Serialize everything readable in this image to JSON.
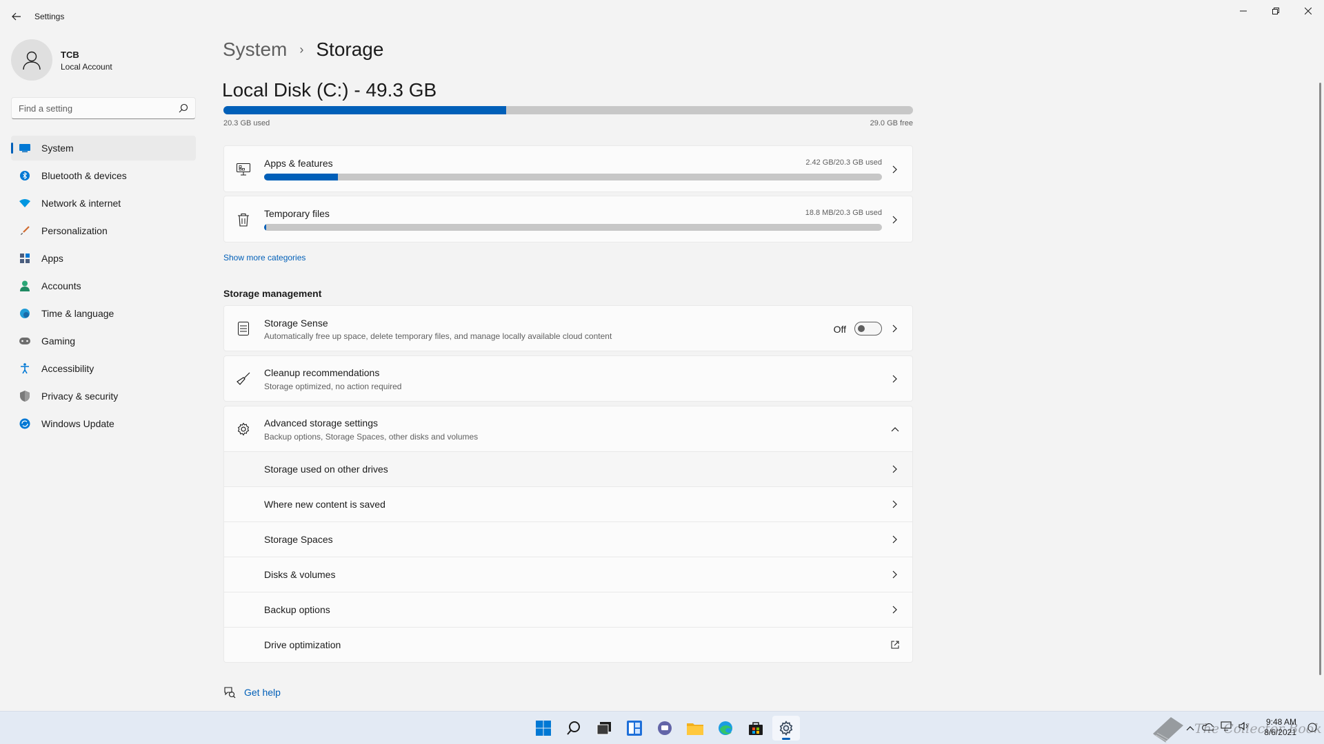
{
  "window": {
    "title": "Settings"
  },
  "user": {
    "name": "TCB",
    "account_type": "Local Account"
  },
  "search": {
    "placeholder": "Find a setting"
  },
  "sidebar": {
    "items": [
      {
        "label": "System",
        "icon": "system-icon",
        "active": true
      },
      {
        "label": "Bluetooth & devices",
        "icon": "bluetooth-icon"
      },
      {
        "label": "Network & internet",
        "icon": "wifi-icon"
      },
      {
        "label": "Personalization",
        "icon": "brush-icon"
      },
      {
        "label": "Apps",
        "icon": "apps-icon"
      },
      {
        "label": "Accounts",
        "icon": "person-icon"
      },
      {
        "label": "Time & language",
        "icon": "globe-icon"
      },
      {
        "label": "Gaming",
        "icon": "gamepad-icon"
      },
      {
        "label": "Accessibility",
        "icon": "accessibility-icon"
      },
      {
        "label": "Privacy & security",
        "icon": "shield-icon"
      },
      {
        "label": "Windows Update",
        "icon": "update-icon"
      }
    ]
  },
  "breadcrumb": {
    "parent": "System",
    "separator": "›",
    "current": "Storage"
  },
  "disk": {
    "title": "Local Disk (C:) - 49.3 GB",
    "used_label": "20.3 GB used",
    "free_label": "29.0 GB free",
    "used_fraction": 0.41
  },
  "categories": [
    {
      "title": "Apps & features",
      "usage": "2.42 GB/20.3 GB used",
      "fraction": 0.119,
      "icon": "apps-features-icon"
    },
    {
      "title": "Temporary files",
      "usage": "18.8 MB/20.3 GB used",
      "fraction": 0.001,
      "icon": "trash-icon"
    }
  ],
  "show_more": "Show more categories",
  "storage_management": {
    "heading": "Storage management",
    "storage_sense": {
      "title": "Storage Sense",
      "description": "Automatically free up space, delete temporary files, and manage locally available cloud content",
      "toggle_label": "Off"
    },
    "cleanup": {
      "title": "Cleanup recommendations",
      "description": "Storage optimized, no action required"
    },
    "advanced": {
      "title": "Advanced storage settings",
      "description": "Backup options, Storage Spaces, other disks and volumes",
      "items": [
        "Storage used on other drives",
        "Where new content is saved",
        "Storage Spaces",
        "Disks & volumes",
        "Backup options",
        "Drive optimization"
      ]
    }
  },
  "help": {
    "label": "Get help"
  },
  "taskbar": {
    "apps": [
      "windows-start-icon",
      "search-icon",
      "task-view-icon",
      "widgets-icon",
      "teams-chat-icon",
      "file-explorer-icon",
      "edge-icon",
      "store-icon",
      "settings-icon"
    ],
    "time": "9:48 AM",
    "date": "8/6/2021",
    "watermark": "The Collector Book"
  },
  "colors": {
    "accent": "#005fb8",
    "background": "#f3f3f3",
    "card": "#fbfbfb",
    "taskbar": "#e3eaf4"
  }
}
